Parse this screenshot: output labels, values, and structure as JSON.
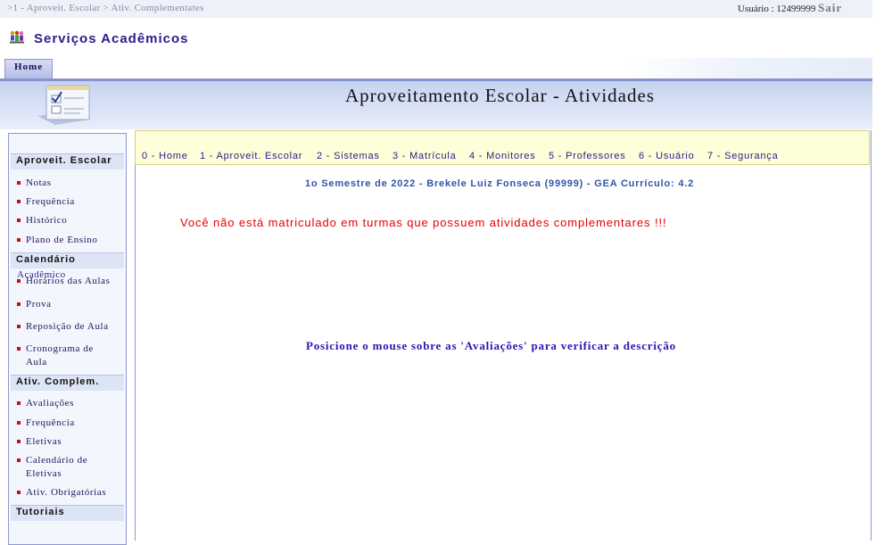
{
  "breadcrumb": {
    "items": [
      ">1 - Aproveit. Escolar",
      "> Ativ. Complementates"
    ]
  },
  "user": {
    "label": "Usuário : 12499999",
    "logout": "Sair"
  },
  "app": {
    "title": "Serviços Acadêmicos",
    "logo_icon": "people-icon"
  },
  "tabs": {
    "home": "Home"
  },
  "page": {
    "title": "Aproveitamento Escolar - Atividades",
    "icon": "checklist-icon"
  },
  "sidebar": {
    "root": "Acadêmico",
    "sections": [
      {
        "title": "Aproveit. Escolar",
        "items": [
          "Notas",
          "Frequência",
          "Histórico",
          "Plano de Ensino"
        ]
      },
      {
        "title": "Calendário",
        "items": [
          "Horários das Aulas",
          "Prova",
          "Reposição de Aula",
          "Cronograma de Aula"
        ]
      },
      {
        "title": "Ativ. Complem.",
        "items": [
          "Avaliações",
          "Frequência",
          "Eletivas",
          "Calendário de Eletivas",
          "Ativ. Obrigatórias"
        ]
      },
      {
        "title": "Tutoriais",
        "items": []
      }
    ]
  },
  "nav": {
    "items": [
      "0 - Home",
      "1 - Aproveit. Escolar",
      "2 - Sistemas",
      "3 - Matrícula",
      "4 - Monitores",
      "5 - Professores",
      "6 - Usuário",
      "7 - Segurança"
    ]
  },
  "main": {
    "semester_info": "1o Semestre de 2022 - Brekele Luiz Fonseca (99999) - GEA Currículo: 4.2",
    "no_activities_message": "Você não está matriculado em turmas que possuem atividades complementares !!!",
    "hint": "Posicione o mouse sobre as 'Avaliações' para verificar a descrição"
  },
  "colors": {
    "accent": "#2a1d8a",
    "bullet": "#c31010",
    "error": "#e40000",
    "nav_bg": "#fefed8"
  }
}
